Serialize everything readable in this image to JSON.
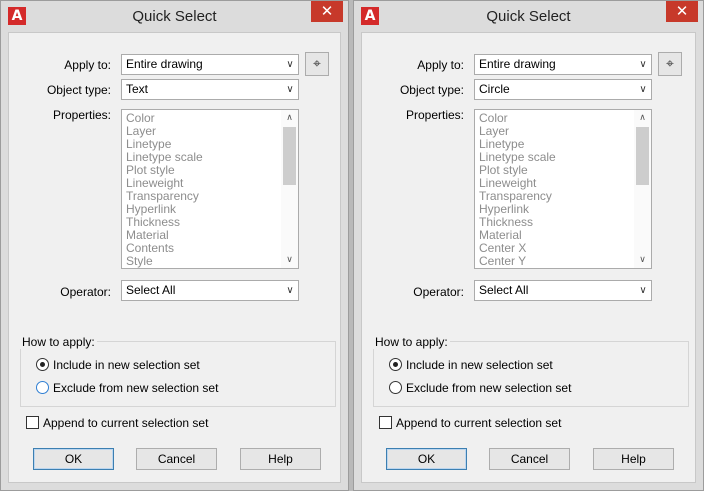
{
  "dialogs": [
    {
      "title": "Quick Select",
      "apply_to_label": "Apply to:",
      "apply_to_value": "Entire drawing",
      "object_type_label": "Object type:",
      "object_type_value": "Text",
      "properties_label": "Properties:",
      "properties": [
        "Color",
        "Layer",
        "Linetype",
        "Linetype scale",
        "Plot style",
        "Lineweight",
        "Transparency",
        "Hyperlink",
        "Thickness",
        "Material",
        "Contents",
        "Style"
      ],
      "operator_label": "Operator:",
      "operator_value": "Select All",
      "how_to_apply_label": "How to apply:",
      "include_label": "Include in new selection set",
      "exclude_label": "Exclude from new selection set",
      "append_label": "Append to current selection set",
      "ok_label": "OK",
      "cancel_label": "Cancel",
      "help_label": "Help"
    },
    {
      "title": "Quick Select",
      "apply_to_label": "Apply to:",
      "apply_to_value": "Entire drawing",
      "object_type_label": "Object type:",
      "object_type_value": "Circle",
      "properties_label": "Properties:",
      "properties": [
        "Color",
        "Layer",
        "Linetype",
        "Linetype scale",
        "Plot style",
        "Lineweight",
        "Transparency",
        "Hyperlink",
        "Thickness",
        "Material",
        "Center X",
        "Center Y"
      ],
      "operator_label": "Operator:",
      "operator_value": "Select All",
      "how_to_apply_label": "How to apply:",
      "include_label": "Include in new selection set",
      "exclude_label": "Exclude from new selection set",
      "append_label": "Append to current selection set",
      "ok_label": "OK",
      "cancel_label": "Cancel",
      "help_label": "Help"
    }
  ],
  "icons": {
    "app": "A",
    "close": "✕",
    "pick": "⌖",
    "chevron_down": "∨",
    "scroll_up": "∧",
    "scroll_down": "∨"
  }
}
